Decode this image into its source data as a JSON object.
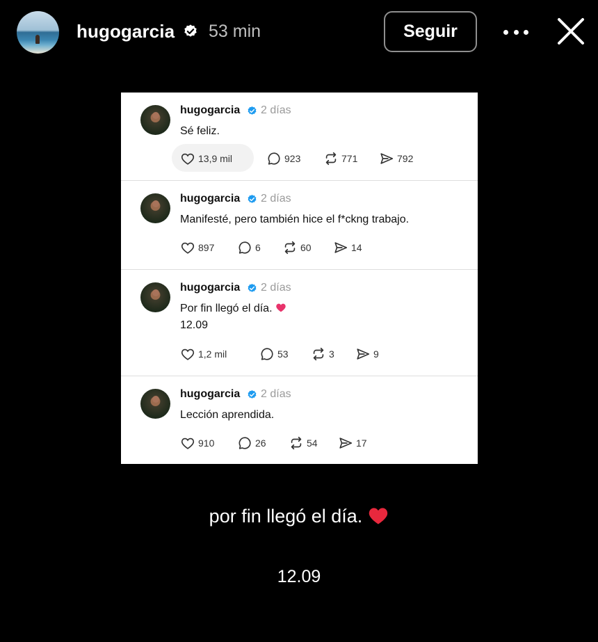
{
  "story": {
    "username": "hugogarcia",
    "time_ago": "53 min",
    "follow_label": "Seguir"
  },
  "posts": [
    {
      "username": "hugogarcia",
      "time_ago": "2 días",
      "text": "Sé feliz.",
      "likes": "13,9 mil",
      "replies": "923",
      "reposts": "771",
      "shares": "792"
    },
    {
      "username": "hugogarcia",
      "time_ago": "2 días",
      "text": "Manifesté, pero también hice el f*ckng trabajo.",
      "likes": "897",
      "replies": "6",
      "reposts": "60",
      "shares": "14"
    },
    {
      "username": "hugogarcia",
      "time_ago": "2 días",
      "text": "Por fin llegó el día.",
      "text_line2": "12.09",
      "likes": "1,2 mil",
      "replies": "53",
      "reposts": "3",
      "shares": "9"
    },
    {
      "username": "hugogarcia",
      "time_ago": "2 días",
      "text": "Lección aprendida.",
      "likes": "910",
      "replies": "26",
      "reposts": "54",
      "shares": "17"
    }
  ],
  "caption": {
    "line1": "por fin llegó el día.",
    "line2": "12.09"
  },
  "colors": {
    "background": "#000000",
    "verified_blue": "#1d9bf0",
    "heart_red": "#e8283d",
    "heart_pink": "#e8336b"
  }
}
